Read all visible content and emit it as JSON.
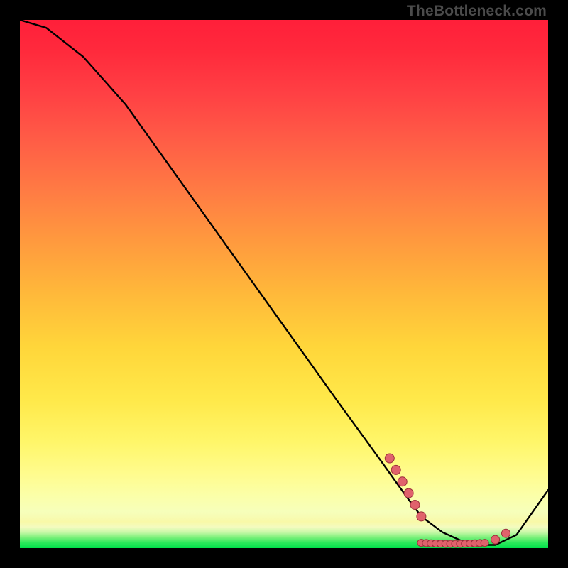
{
  "watermark": "TheBottleneck.com",
  "colors": {
    "frame": "#000000",
    "watermark": "#4b4b4b",
    "curve_stroke": "#000000",
    "marker_fill": "#e0626c",
    "marker_edge": "#9c2f3a"
  },
  "chart_data": {
    "type": "line",
    "title": "",
    "xlabel": "",
    "ylabel": "",
    "xlim": [
      0,
      100
    ],
    "ylim": [
      0,
      100
    ],
    "grid": false,
    "legend": false,
    "series": [
      {
        "name": "curve",
        "x": [
          0,
          5,
          12,
          20,
          30,
          40,
          50,
          60,
          68,
          73,
          76,
          80,
          84,
          88,
          90,
          94,
          100
        ],
        "y": [
          100,
          98.5,
          93,
          84,
          70,
          56,
          42,
          28,
          17,
          10,
          6,
          3,
          1.2,
          0.6,
          0.6,
          2.5,
          11
        ]
      }
    ],
    "markers": [
      {
        "name": "left-cluster",
        "x_range": [
          70,
          76
        ],
        "y": 7,
        "count": 6
      },
      {
        "name": "valley-floor",
        "x_range": [
          76,
          88
        ],
        "y": 1,
        "count": 14
      },
      {
        "name": "right-pair",
        "x": [
          90,
          92
        ],
        "y": [
          1.6,
          2.8
        ]
      }
    ]
  }
}
